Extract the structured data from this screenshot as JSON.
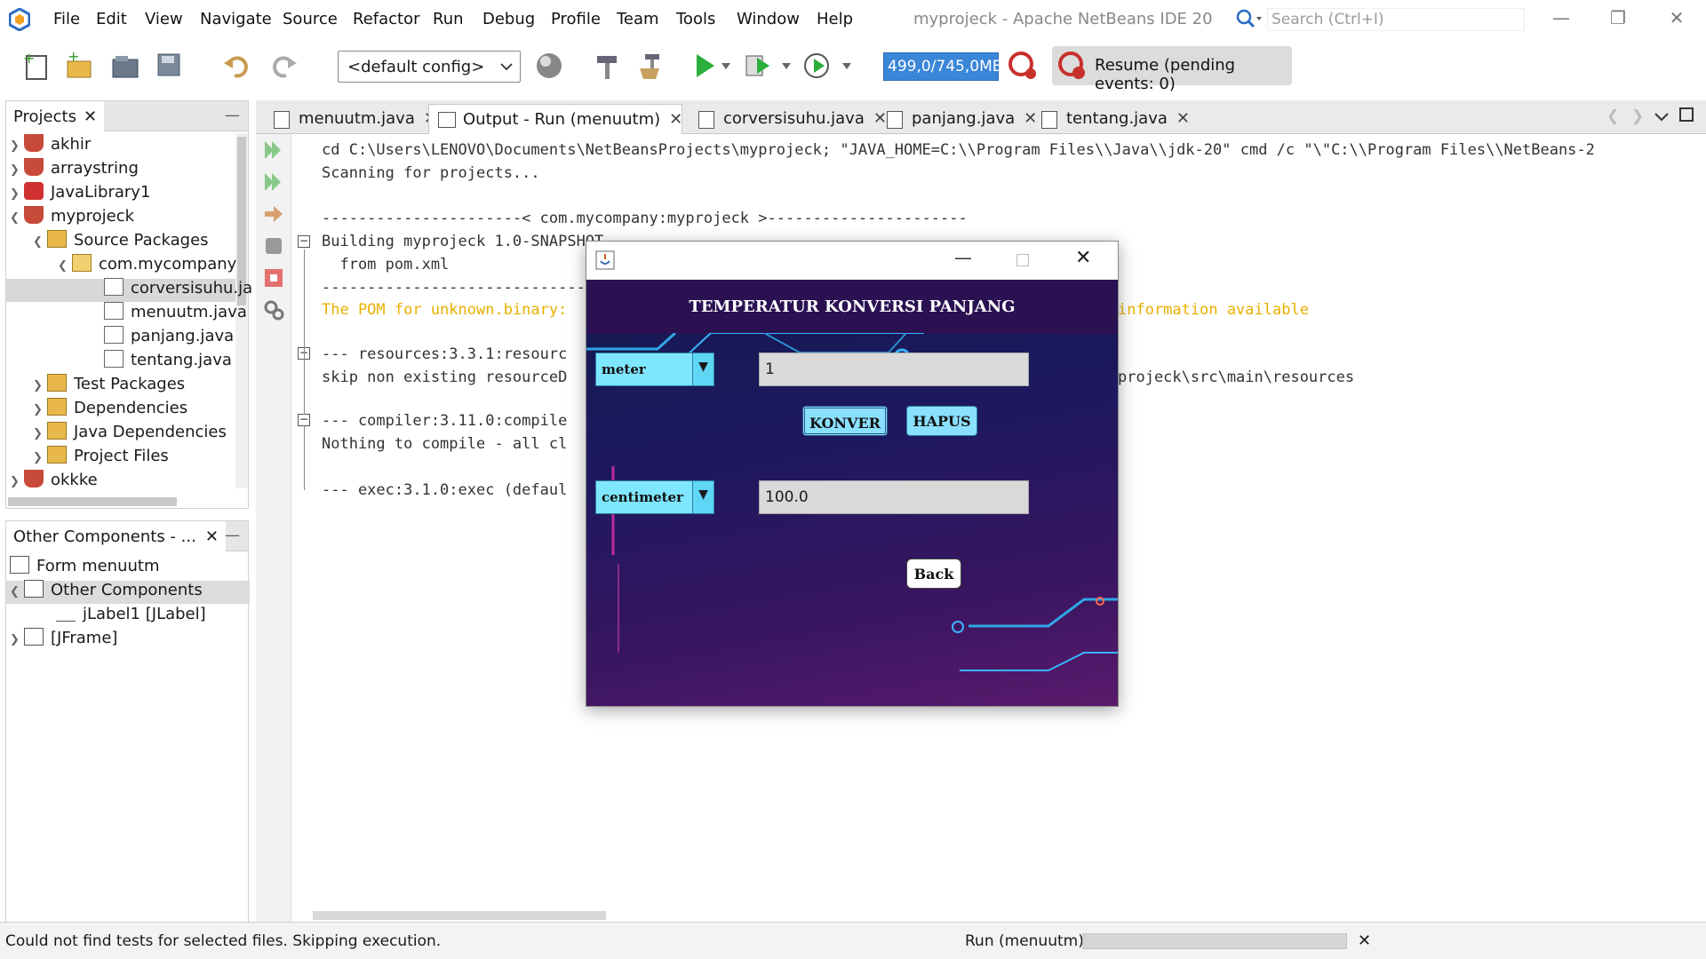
{
  "menubar": {
    "items": [
      "File",
      "Edit",
      "View",
      "Navigate",
      "Source",
      "Refactor",
      "Run",
      "Debug",
      "Profile",
      "Team",
      "Tools",
      "Window",
      "Help"
    ],
    "title": "myprojeck - Apache NetBeans IDE 20",
    "search_placeholder": "Search (Ctrl+I)"
  },
  "toolbar": {
    "config": "<default config>",
    "memory": "499,0/745,0MB",
    "resume": "Resume (pending events: 0)"
  },
  "projects": {
    "tab": "Projects",
    "items": [
      "akhir",
      "arraystring",
      "JavaLibrary1",
      "myprojeck",
      "Source Packages",
      "com.mycompany",
      "corversisuhu.ja",
      "menuutm.java",
      "panjang.java",
      "tentang.java",
      "Test Packages",
      "Dependencies",
      "Java Dependencies",
      "Project Files",
      "okkke"
    ]
  },
  "components": {
    "tab": "Other Components - ...",
    "items": [
      "Form menuutm",
      "Other Components",
      "jLabel1 [JLabel]",
      "[JFrame]"
    ]
  },
  "editor": {
    "tabs": [
      "menuutm.java",
      "Output - Run (menuutm)",
      "corversisuhu.java",
      "panjang.java",
      "tentang.java"
    ]
  },
  "output": {
    "lines": [
      "cd C:\\Users\\LENOVO\\Documents\\NetBeansProjects\\myprojeck; \"JAVA_HOME=C:\\\\Program Files\\\\Java\\\\jdk-20\" cmd /c \"\\\"C:\\\\Program Files\\\\NetBeans-2",
      "Scanning for projects...",
      "----------------------< com.mycompany:myprojeck >----------------------",
      "Building myprojeck 1.0-SNAPSHOT",
      "  from pom.xml",
      "--------------------------------[ jar ]---------------------------------",
      "The POM for unknown.binary:",
      "--- resources:3.3.1:resourc",
      "skip non existing resourceD",
      "--- compiler:3.11.0:compile",
      "Nothing to compile - all cl",
      "--- exec:3.1.0:exec (defaul"
    ],
    "warn_tail": "information available",
    "path_tail": "projeck\\src\\main\\resources"
  },
  "status": {
    "message": "Could not find tests for selected files. Skipping execution.",
    "task": "Run (menuutm)"
  },
  "dialog": {
    "header": "TEMPERATUR KONVERSI PANJANG",
    "from_unit": "meter",
    "from_value": "1",
    "to_unit": "centimeter",
    "to_value": "100.0",
    "konver_label": "KONVER",
    "hapus_label": "HAPUS",
    "back_label": "Back"
  },
  "colors": {
    "accent": "#3a86d8",
    "combo": "#7fe6ff",
    "warning_text": "#e8b000"
  }
}
